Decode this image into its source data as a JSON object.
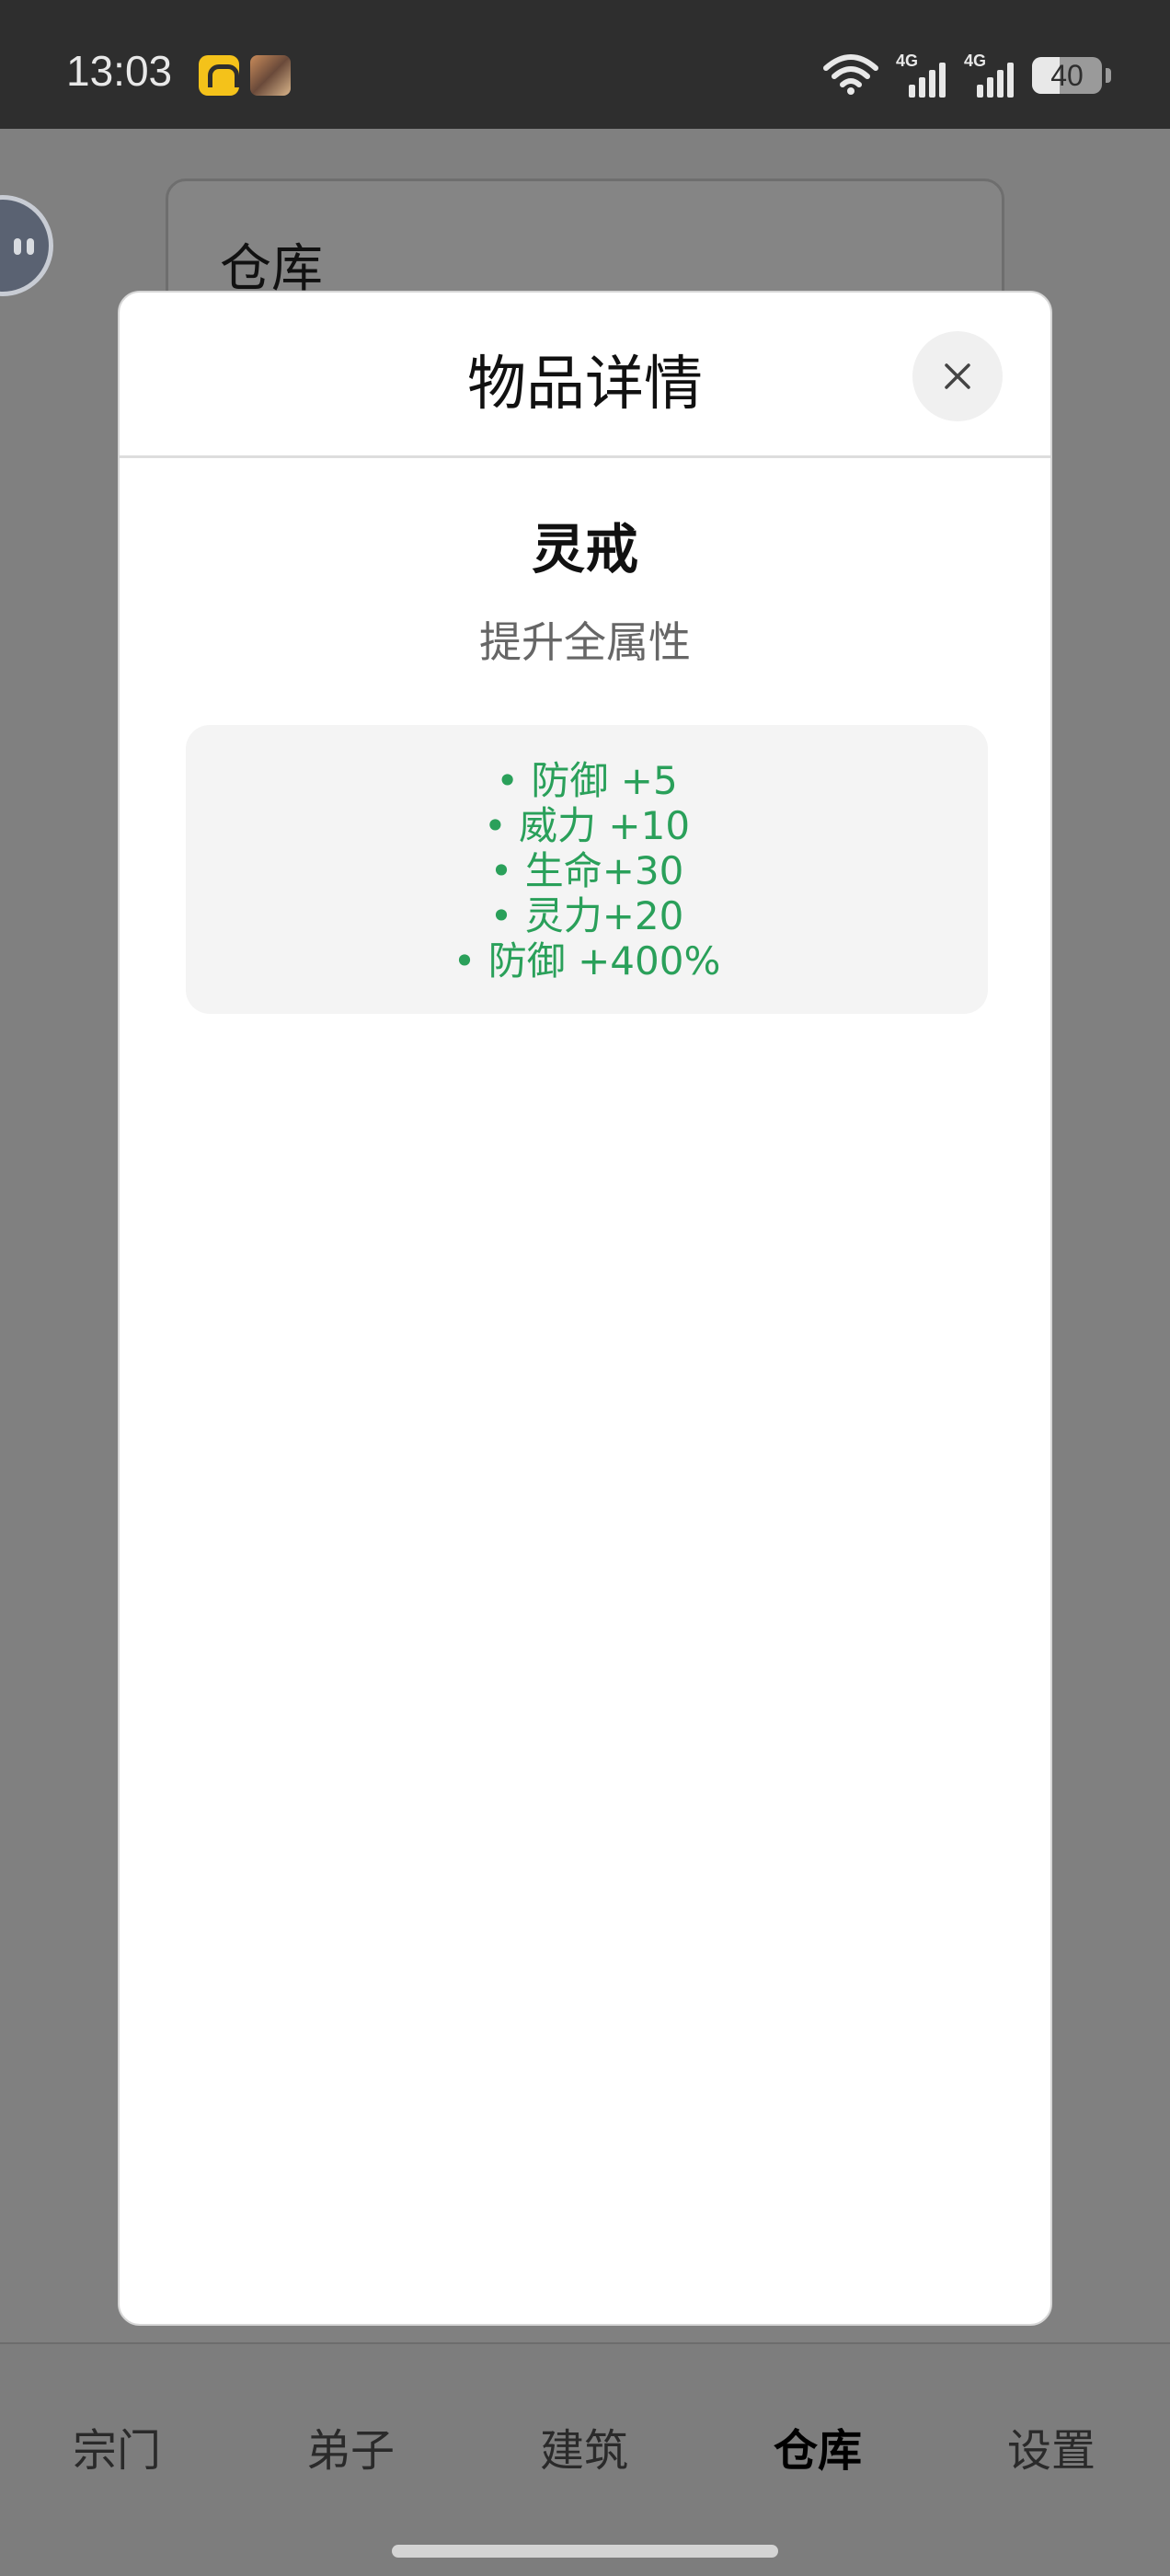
{
  "status_bar": {
    "time": "13:03",
    "signal_1_tag": "4G",
    "signal_2_tag": "4G",
    "battery_text": "40",
    "battery_percent": 40,
    "notification_icons": [
      "app-a-icon",
      "game-avatar-icon"
    ]
  },
  "background_page": {
    "card_title": "仓库"
  },
  "modal": {
    "title": "物品详情",
    "close_icon": "close-icon",
    "item_name": "灵戒",
    "item_description": "提升全属性",
    "attributes": [
      "• 防御 +5",
      "• 威力 +10",
      "• 生命+30",
      "• 灵力+20",
      "• 防御 +400%"
    ]
  },
  "tab_bar": {
    "tabs": [
      {
        "label": "宗门",
        "active": false
      },
      {
        "label": "弟子",
        "active": false
      },
      {
        "label": "建筑",
        "active": false
      },
      {
        "label": "仓库",
        "active": true
      },
      {
        "label": "设置",
        "active": false
      }
    ]
  },
  "colors": {
    "accent_green": "#2aa05a",
    "overlay": "#808080"
  }
}
